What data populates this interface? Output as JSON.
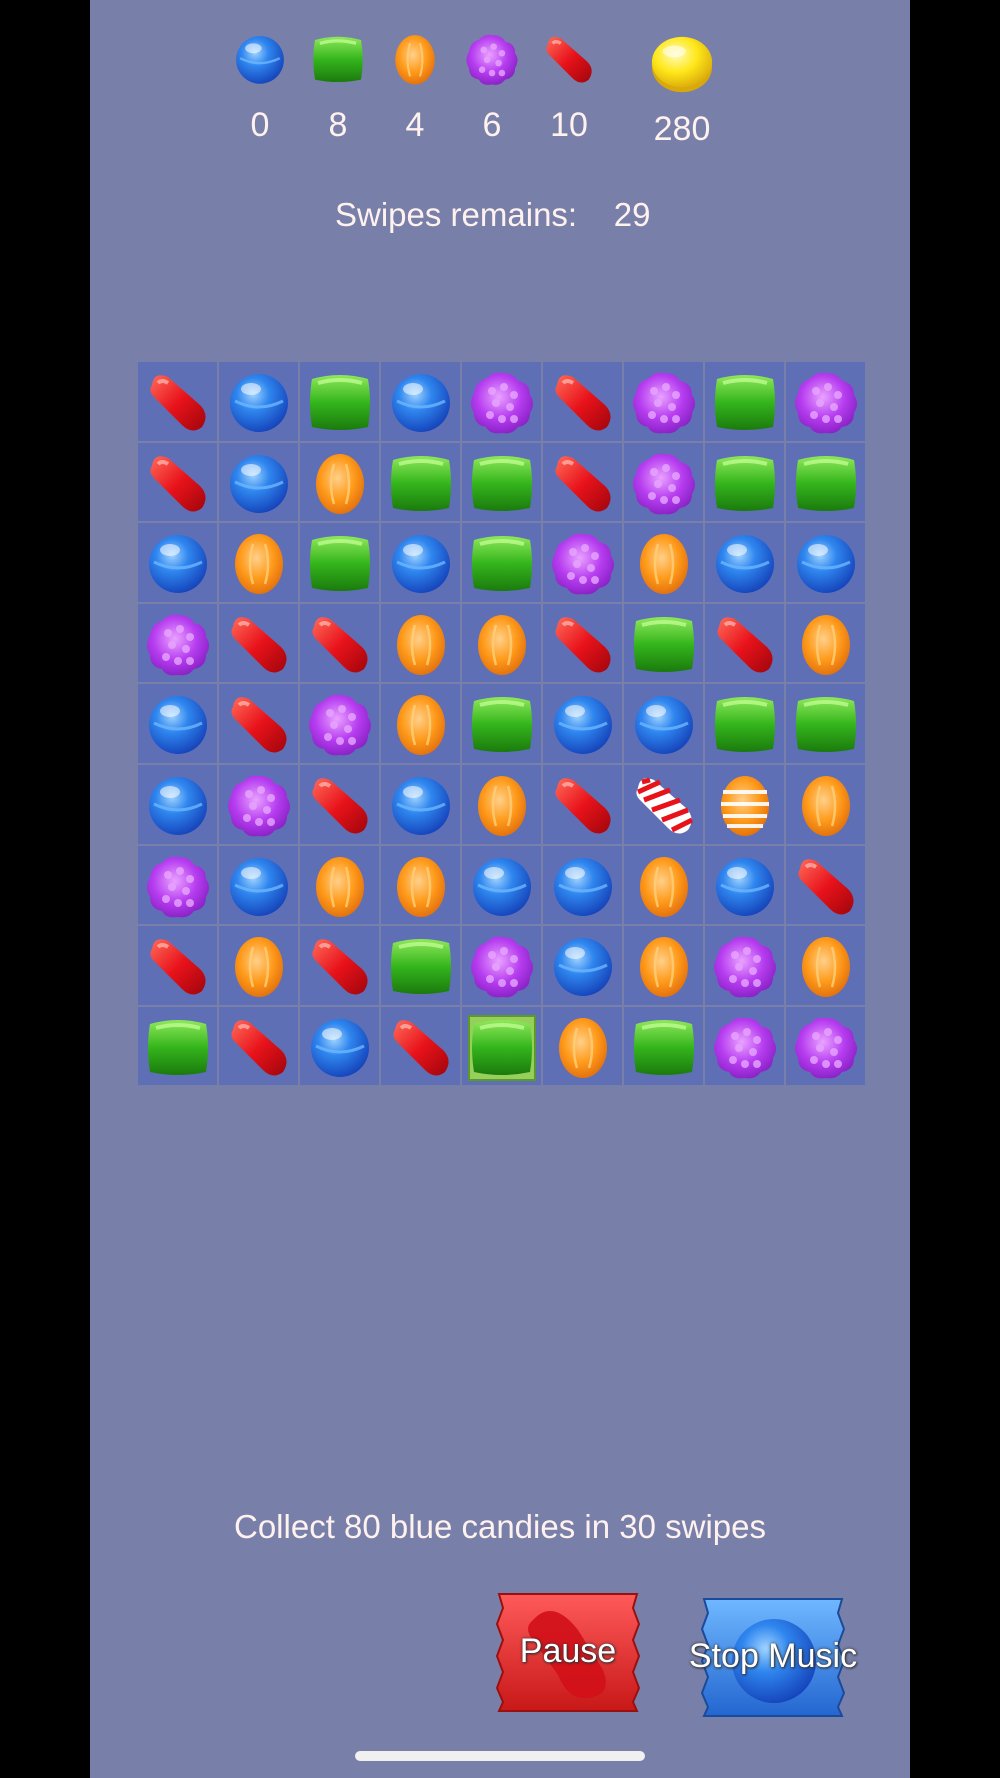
{
  "counters": [
    {
      "candy": "blue",
      "value": "0"
    },
    {
      "candy": "green",
      "value": "8"
    },
    {
      "candy": "orange",
      "value": "4"
    },
    {
      "candy": "purple",
      "value": "6"
    },
    {
      "candy": "red",
      "value": "10"
    },
    {
      "candy": "coin",
      "value": "280"
    }
  ],
  "swipes": {
    "label": "Swipes remains:",
    "value": "29"
  },
  "board": [
    [
      "red",
      "blue",
      "green",
      "blue",
      "purple",
      "red",
      "purple",
      "green",
      "purple"
    ],
    [
      "red",
      "blue",
      "orange",
      "green",
      "green",
      "red",
      "purple",
      "green",
      "green"
    ],
    [
      "blue",
      "orange",
      "green",
      "blue",
      "green",
      "purple",
      "orange",
      "blue",
      "blue"
    ],
    [
      "purple",
      "red",
      "red",
      "orange",
      "orange",
      "red",
      "green",
      "red",
      "orange"
    ],
    [
      "blue",
      "red",
      "purple",
      "orange",
      "green",
      "blue",
      "blue",
      "green",
      "green"
    ],
    [
      "blue",
      "purple",
      "red",
      "blue",
      "orange",
      "red",
      "striped-red",
      "striped-orange",
      "orange"
    ],
    [
      "purple",
      "blue",
      "orange",
      "orange",
      "blue",
      "blue",
      "orange",
      "blue",
      "red"
    ],
    [
      "red",
      "orange",
      "red",
      "green",
      "purple",
      "blue",
      "orange",
      "purple",
      "orange"
    ],
    [
      "green",
      "red",
      "blue",
      "red",
      "wrapped-green",
      "orange",
      "green",
      "purple",
      "purple"
    ]
  ],
  "goal": "Collect 80 blue candies in 30 swipes",
  "buttons": {
    "pause": "Pause",
    "stop_music": "Stop Music"
  },
  "colors": {
    "background": "#7880aa",
    "board_cell": "#5f6fb6",
    "text": "#fff2ee"
  }
}
